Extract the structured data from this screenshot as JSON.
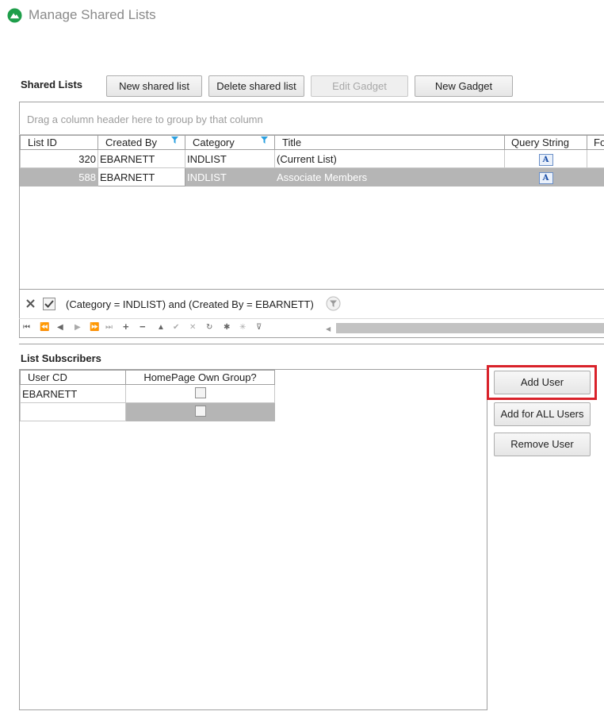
{
  "window": {
    "title": "Manage Shared Lists"
  },
  "shared_lists": {
    "section_title": "Shared Lists",
    "buttons": {
      "new_shared_list": "New shared list",
      "delete_shared_list": "Delete shared list",
      "edit_gadget": "Edit Gadget",
      "new_gadget": "New Gadget"
    },
    "group_hint": "Drag a column header here to group by that column",
    "columns": [
      "List ID",
      "Created By",
      "Category",
      "Title",
      "Query String",
      "Fo"
    ],
    "rows": [
      {
        "list_id": "320",
        "created_by": "EBARNETT",
        "category": "INDLIST",
        "title": "(Current List)",
        "query_icon": "text-document-icon"
      },
      {
        "list_id": "588",
        "created_by": "EBARNETT",
        "category": "INDLIST",
        "title": "Associate Members",
        "query_icon": "text-document-icon"
      }
    ],
    "filter_text": "(Category = INDLIST) and (Created By = EBARNETT)",
    "query_glyph": "A"
  },
  "subscribers": {
    "section_title": "List Subscribers",
    "columns": [
      "User CD",
      "HomePage Own Group?"
    ],
    "rows": [
      {
        "user_cd": "EBARNETT",
        "own_group": false
      },
      {
        "user_cd": "",
        "own_group": false
      }
    ],
    "buttons": {
      "add_user": "Add User",
      "add_for_all_users": "Add for ALL Users",
      "remove_user": "Remove User"
    }
  },
  "colors": {
    "highlight": "#d9222a",
    "selected_row": "#b5b5b5",
    "logo": "#1e9e4a"
  }
}
